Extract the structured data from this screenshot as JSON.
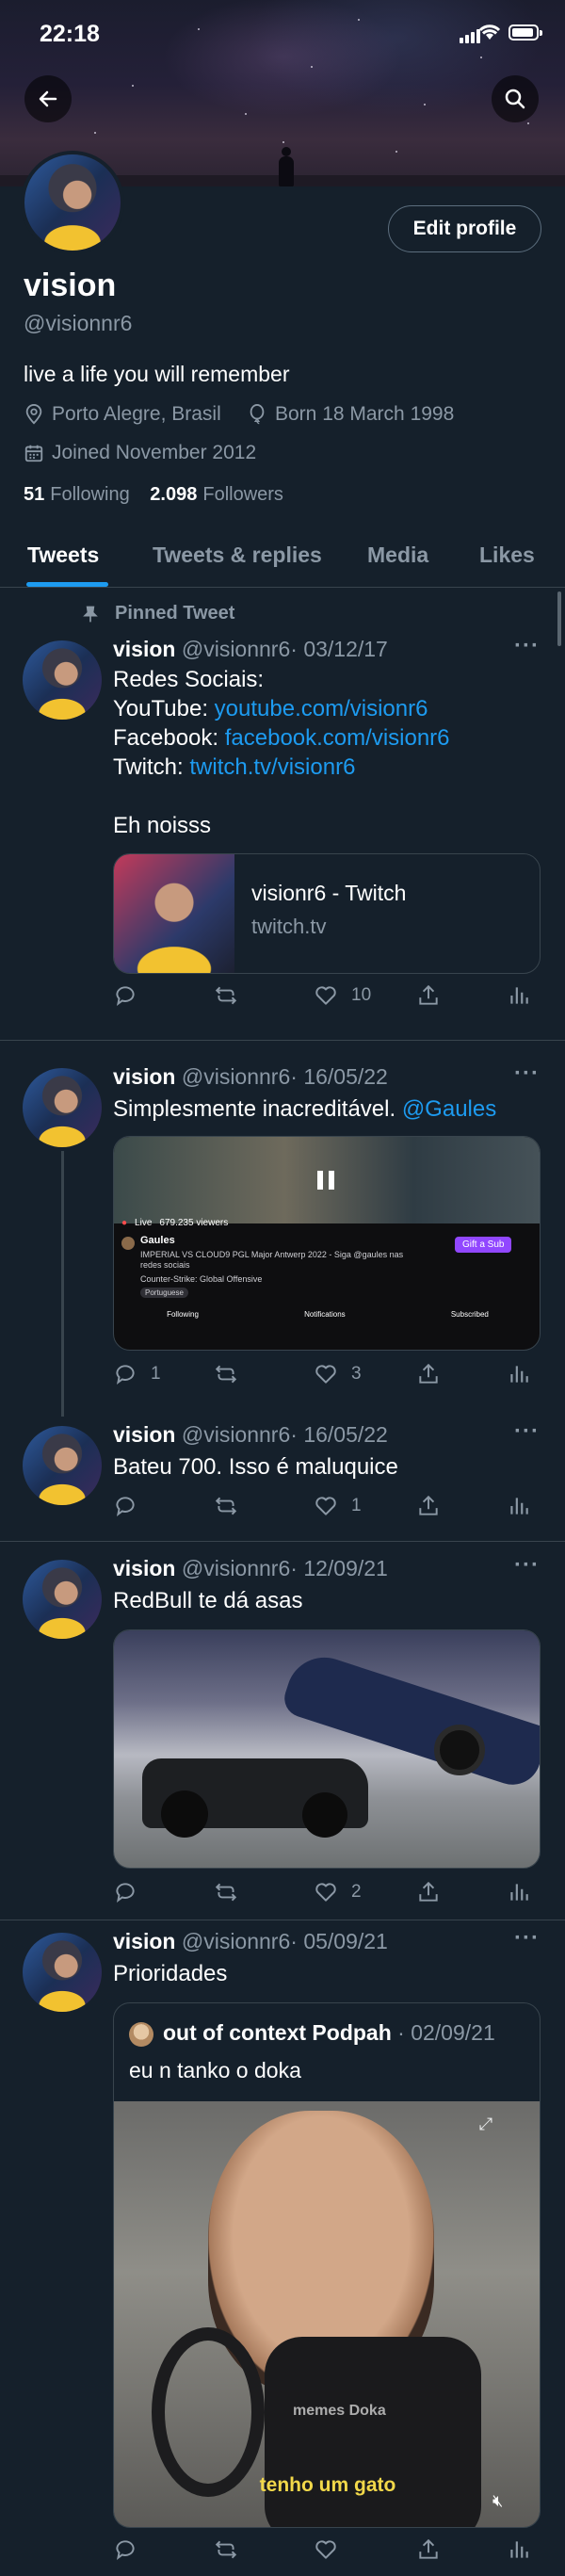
{
  "status": {
    "time": "22:18"
  },
  "profile": {
    "name": "vision",
    "handle": "@visionnr6",
    "bio": "live a life you will remember",
    "location": "Porto Alegre, Brasil",
    "born": "Born 18 March 1998",
    "joined": "Joined November 2012",
    "following_count": "51",
    "following_label": "Following",
    "followers_count": "2.098",
    "followers_label": "Followers",
    "edit_label": "Edit profile"
  },
  "tabs": [
    "Tweets",
    "Tweets & replies",
    "Media",
    "Likes"
  ],
  "tweets": [
    {
      "pinned_label": "Pinned Tweet",
      "name": "vision",
      "handle": "@visionnr6",
      "date": "· 03/12/17",
      "lines": [
        "Redes Sociais:",
        "YouTube: ",
        "Facebook: ",
        "Twitch: ",
        "Eh noisss"
      ],
      "links": [
        "youtube.com/visionr6",
        "facebook.com/visionr6",
        "twitch.tv/visionr6"
      ],
      "card_title": "visionr6 - Twitch",
      "card_domain": "twitch.tv",
      "likes": "10"
    },
    {
      "name": "vision",
      "handle": "@visionnr6",
      "date": "· 16/05/22",
      "text": "Simplesmente inacreditável. ",
      "mention": "@Gaules",
      "embed": {
        "live": "Live",
        "viewers": "679.235 viewers",
        "channel": "Gaules",
        "title": "IMPERIAL VS CLOUD9 PGL Major Antwerp 2022 - Siga @gaules nas redes sociais",
        "game": "Counter-Strike: Global Offensive",
        "tag": "Portuguese",
        "sub_button": "Gift a Sub",
        "bar": [
          "Following",
          "Notifications",
          "Subscribed"
        ]
      },
      "replies": "1",
      "likes": "3"
    },
    {
      "name": "vision",
      "handle": "@visionnr6",
      "date": "· 16/05/22",
      "text": "Bateu 700. Isso é maluquice",
      "likes": "1"
    },
    {
      "name": "vision",
      "handle": "@visionnr6",
      "date": "· 12/09/21",
      "text": "RedBull te dá asas",
      "likes": "2"
    },
    {
      "name": "vision",
      "handle": "@visionnr6",
      "date": "· 05/09/21",
      "text": "Prioridades",
      "quote_name": "out of context Podpah",
      "quote_date": "· 02/09/21",
      "quote_text": "eu n tanko o doka",
      "subtitle": "tenho um gato",
      "watermark": "memes Doka"
    }
  ]
}
